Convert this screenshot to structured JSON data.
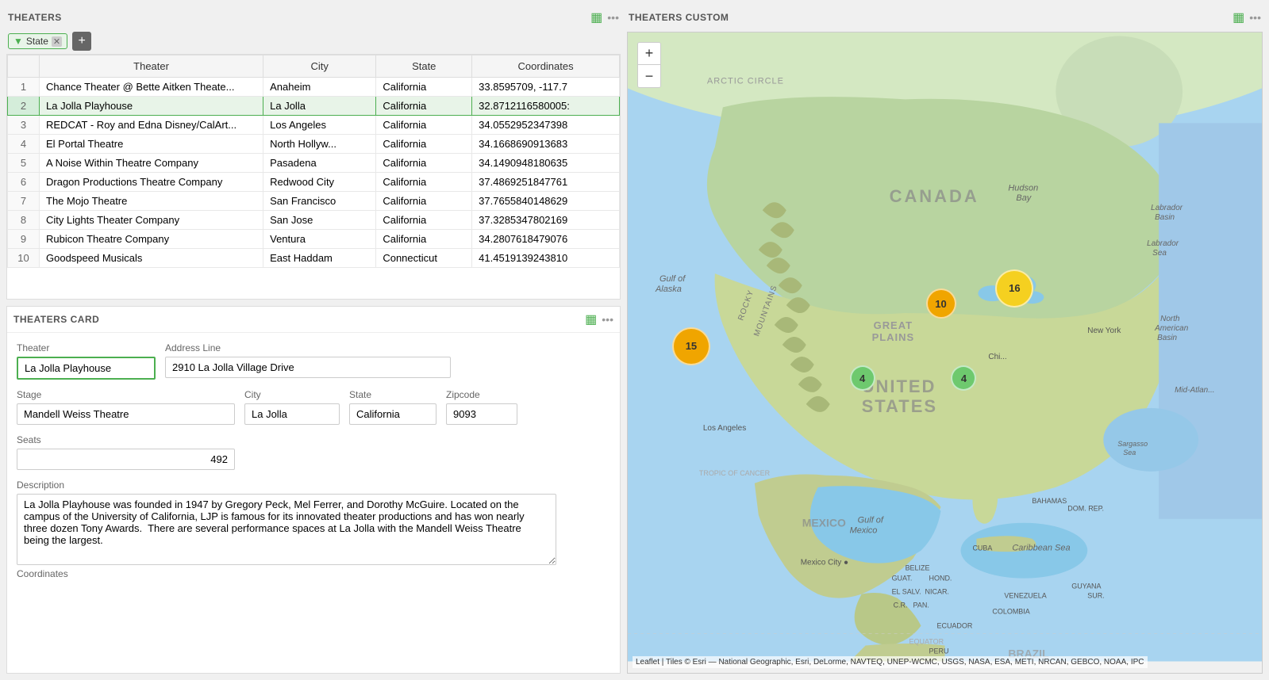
{
  "theaters_table": {
    "title": "THEATERS",
    "filter_label": "State",
    "columns": [
      "Theater",
      "City",
      "State",
      "Coordinates"
    ],
    "rows": [
      {
        "num": 1,
        "theater": "Chance Theater @ Bette Aitken Theate...",
        "city": "Anaheim",
        "state": "California",
        "coords": "33.8595709, -117.7"
      },
      {
        "num": 2,
        "theater": "La Jolla Playhouse",
        "city": "La Jolla",
        "state": "California",
        "coords": "32.8712116580005:"
      },
      {
        "num": 3,
        "theater": "REDCAT - Roy and Edna Disney/CalArt...",
        "city": "Los Angeles",
        "state": "California",
        "coords": "34.0552952347398"
      },
      {
        "num": 4,
        "theater": "El Portal Theatre",
        "city": "North Hollyw...",
        "state": "California",
        "coords": "34.1668690913683"
      },
      {
        "num": 5,
        "theater": "A Noise Within Theatre Company",
        "city": "Pasadena",
        "state": "California",
        "coords": "34.1490948180635"
      },
      {
        "num": 6,
        "theater": "Dragon Productions Theatre Company",
        "city": "Redwood City",
        "state": "California",
        "coords": "37.4869251847761"
      },
      {
        "num": 7,
        "theater": "The Mojo Theatre",
        "city": "San Francisco",
        "state": "California",
        "coords": "37.7655840148629"
      },
      {
        "num": 8,
        "theater": "City Lights Theater Company",
        "city": "San Jose",
        "state": "California",
        "coords": "37.3285347802169"
      },
      {
        "num": 9,
        "theater": "Rubicon Theatre Company",
        "city": "Ventura",
        "state": "California",
        "coords": "34.2807618479076"
      },
      {
        "num": 10,
        "theater": "Goodspeed Musicals",
        "city": "East Haddam",
        "state": "Connecticut",
        "coords": "41.4519139243810"
      }
    ]
  },
  "theaters_card": {
    "title": "THEATERS Card",
    "fields": {
      "theater_label": "Theater",
      "theater_value": "La Jolla Playhouse",
      "address_label": "Address Line",
      "address_value": "2910 La Jolla Village Drive",
      "stage_label": "Stage",
      "stage_value": "Mandell Weiss Theatre",
      "city_label": "City",
      "city_value": "La Jolla",
      "state_label": "State",
      "state_value": "California",
      "zipcode_label": "Zipcode",
      "zipcode_value": "9093",
      "seats_label": "Seats",
      "seats_value": "492",
      "description_label": "Description",
      "description_value": "La Jolla Playhouse was founded in 1947 by Gregory Peck, Mel Ferrer, and Dorothy McGuire. Located on the campus of the University of California, LJP is famous for its innovated theater productions and has won nearly three dozen Tony Awards.  There are several performance spaces at La Jolla with the Mandell Weiss Theatre being the largest.",
      "coordinates_label": "Coordinates"
    }
  },
  "map": {
    "title": "THEATERS Custom",
    "attribution": "Leaflet | Tiles © Esri — National Geographic, Esri, DeLorme, NAVTEQ, UNEP-WCMC, USGS, NASA, ESA, METI, NRCAN, GEBCO, NOAA, IPC",
    "clusters": [
      {
        "id": "c15",
        "label": "15",
        "size": "large",
        "color": "orange",
        "top": "47%",
        "left": "7%"
      },
      {
        "id": "c10",
        "label": "10",
        "size": "medium",
        "color": "orange",
        "top": "40%",
        "left": "47%"
      },
      {
        "id": "c16",
        "label": "16",
        "size": "large",
        "color": "yellow",
        "top": "38%",
        "left": "59%"
      },
      {
        "id": "c4a",
        "label": "4",
        "size": "small",
        "color": "green",
        "top": "52%",
        "left": "37%"
      },
      {
        "id": "c4b",
        "label": "4",
        "size": "small",
        "color": "green",
        "top": "52%",
        "left": "52%"
      }
    ],
    "zoom_plus": "+",
    "zoom_minus": "−"
  }
}
